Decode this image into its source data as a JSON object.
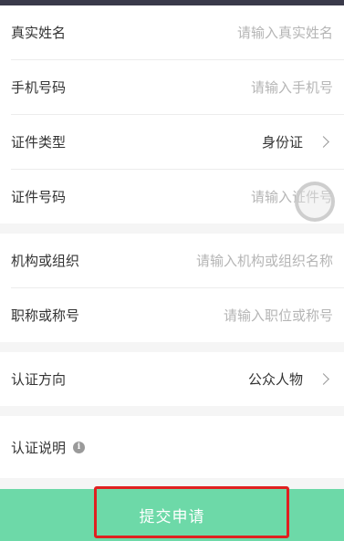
{
  "form": {
    "rows_group1": [
      {
        "label": "真实姓名",
        "value": "请输入真实姓名",
        "type": "input"
      },
      {
        "label": "手机号码",
        "value": "请输入手机号",
        "type": "input"
      },
      {
        "label": "证件类型",
        "value": "身份证",
        "type": "select"
      },
      {
        "label": "证件号码",
        "value": "请输入证件号",
        "type": "input"
      }
    ],
    "rows_group2": [
      {
        "label": "机构或组织",
        "value": "请输入机构或组织名称",
        "type": "input"
      },
      {
        "label": "职称或称号",
        "value": "请输入职位或称号",
        "type": "input"
      }
    ],
    "direction": {
      "label": "认证方向",
      "value": "公众人物"
    },
    "description": {
      "label": "认证说明",
      "icon": "info-icon"
    }
  },
  "submit": {
    "label": "提交申请"
  },
  "colors": {
    "accent": "#6dd9a8",
    "highlight": "#e02020"
  }
}
